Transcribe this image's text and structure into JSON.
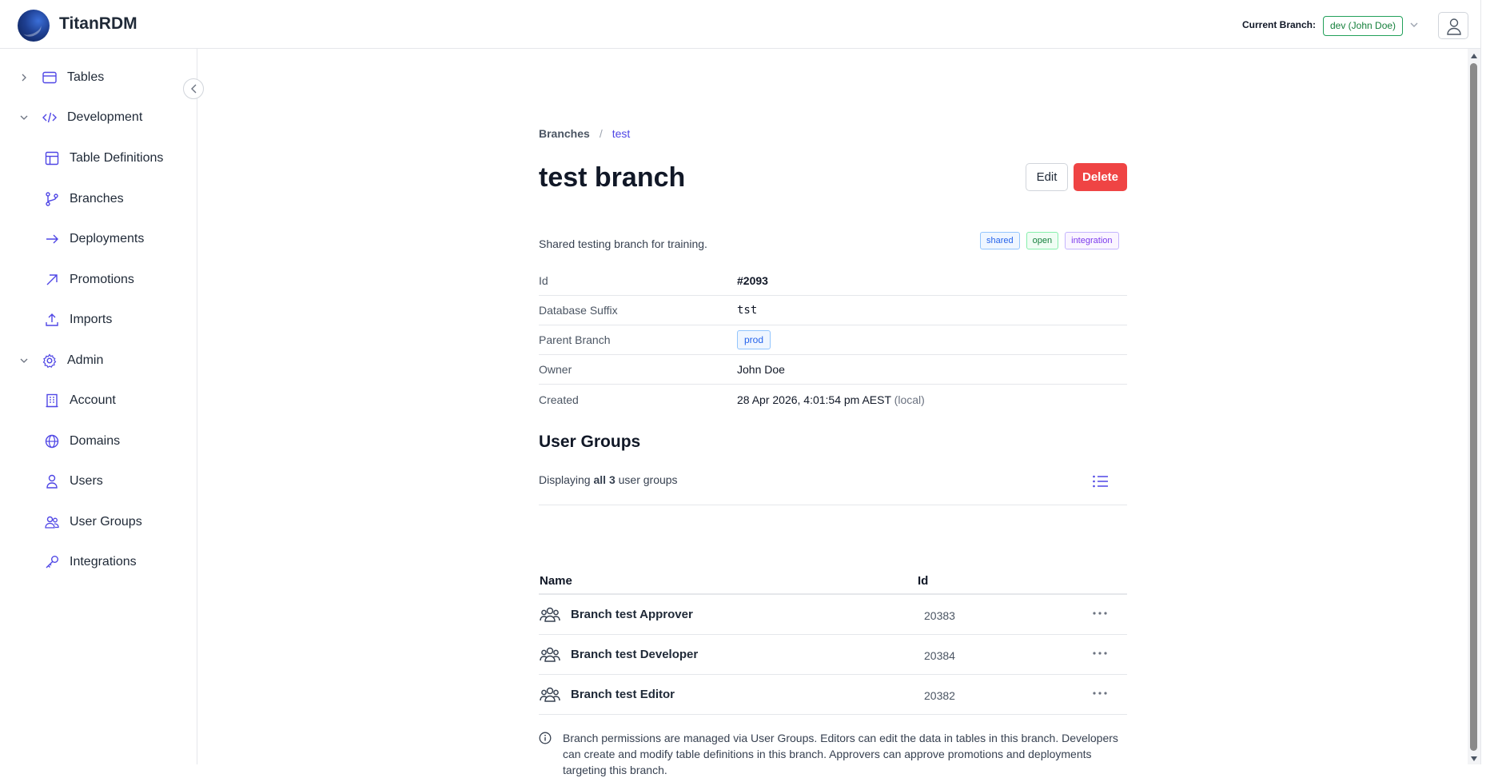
{
  "app": {
    "title": "TitanRDM"
  },
  "header": {
    "current_branch_label": "Current Branch:",
    "current_branch_value": "dev (John Doe)"
  },
  "sidebar": {
    "tables": "Tables",
    "development": "Development",
    "table_definitions": "Table Definitions",
    "branches": "Branches",
    "deployments": "Deployments",
    "promotions": "Promotions",
    "imports": "Imports",
    "admin": "Admin",
    "account": "Account",
    "domains": "Domains",
    "users": "Users",
    "user_groups": "User Groups",
    "integrations": "Integrations"
  },
  "breadcrumb": {
    "root": "Branches",
    "sep": "/",
    "current": "test"
  },
  "page": {
    "title": "test branch",
    "edit_label": "Edit",
    "delete_label": "Delete",
    "description": "Shared testing branch for training.",
    "tags": {
      "shared": "shared",
      "open": "open",
      "integration": "integration"
    }
  },
  "props": {
    "id_label": "Id",
    "id_value": "#2093",
    "suffix_label": "Database Suffix",
    "suffix_value": "tst",
    "parent_label": "Parent Branch",
    "parent_value": "prod",
    "owner_label": "Owner",
    "owner_value": "John Doe",
    "created_label": "Created",
    "created_value": "28 Apr 2026, 4:01:54 pm AEST",
    "created_note": "(local)"
  },
  "user_groups": {
    "title": "User Groups",
    "summary_prefix": "Displaying",
    "summary_bold": "all 3",
    "summary_suffix": "user groups",
    "col_name": "Name",
    "col_id": "Id",
    "rows": [
      {
        "name": "Branch test Approver",
        "id": "20383"
      },
      {
        "name": "Branch test Developer",
        "id": "20384"
      },
      {
        "name": "Branch test Editor",
        "id": "20382"
      }
    ],
    "info": "Branch permissions are managed via User Groups. Editors can edit the data in tables in this branch. Developers can create and modify table definitions in this branch. Approvers can approve promotions and deployments targeting this branch."
  },
  "colors": {
    "accent": "#4f46e5",
    "danger": "#ef4444",
    "success": "#16803c"
  }
}
